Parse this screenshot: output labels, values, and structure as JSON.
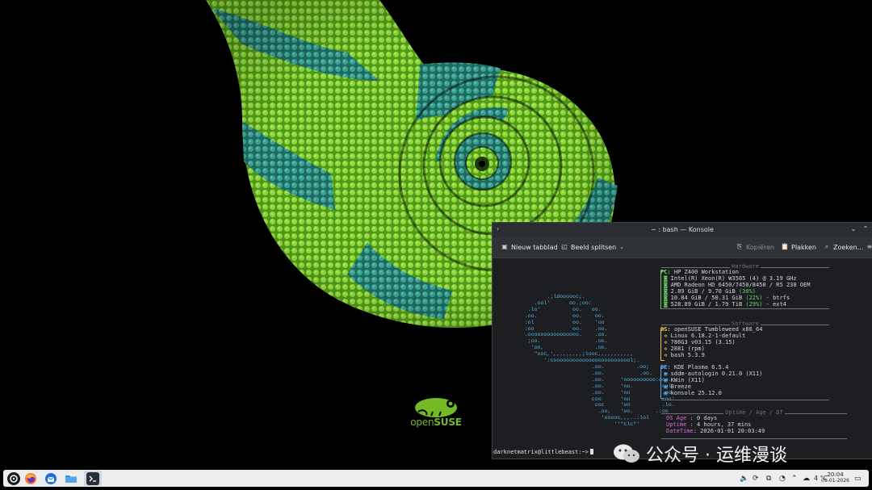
{
  "konsole": {
    "title": "~ : bash — Konsole",
    "toolbar": {
      "new_tab": "Nieuw tabblad",
      "split_view": "Beeld splitsen",
      "copy": "Kopiëren",
      "paste": "Plakken",
      "search": "Zoeken..."
    },
    "sections": {
      "hardware": "Hardware",
      "software": "Software",
      "uptime": "Uptime / Age / DT"
    },
    "hardware": [
      {
        "key": "PC:",
        "value": "HP Z400 Workstation"
      },
      {
        "key": "",
        "value": "Intel(R) Xeon(R) W3565 (4) @ 3.19 GHz"
      },
      {
        "key": "",
        "value": "AMD Radeon HD 6450/7450/8450 / R5 230 OEM"
      },
      {
        "key": "",
        "value": "2.89 GiB / 9.70 GiB ",
        "pct": "(30%)"
      },
      {
        "key": "",
        "value": "10.84 GiB / 50.31 GiB ",
        "pct": "(22%)",
        "suffix": " - btrfs"
      },
      {
        "key": "",
        "value": "528.89 GiB / 1.79 TiB ",
        "pct": "(29%)",
        "suffix": " - ext4"
      }
    ],
    "software_os": [
      {
        "key": "OS:",
        "value": "openSUSE Tumbleweed x86_64"
      },
      {
        "key": "",
        "value": "Linux 6.18.2-1-default"
      },
      {
        "key": "",
        "value": "786G3 v03.15 (3.15)"
      },
      {
        "key": "",
        "value": "2881 (rpm)"
      },
      {
        "key": "",
        "value": "bash 5.3.9"
      }
    ],
    "software_de": [
      {
        "key": "DE:",
        "value": "KDE Plasma 6.5.4"
      },
      {
        "key": "",
        "value": "sddm-autologin 0.21.0 (X11)"
      },
      {
        "key": "",
        "value": "KWin (X11)"
      },
      {
        "key": "",
        "value": "Breeze"
      },
      {
        "key": "",
        "value": "konsole 25.12.0"
      }
    ],
    "uptime": [
      {
        "key": "OS Age ",
        "value": ": 0 days"
      },
      {
        "key": "Uptime ",
        "value": ": 4 hours, 37 mins"
      },
      {
        "key": "DateTime",
        "value": ": 2026-01-01 20:03:49"
      }
    ],
    "prompt": "darknetmatrix@littlebeast:~>"
  },
  "desktop": {
    "logo_text_open": "open",
    "logo_text_suse": "SUSE"
  },
  "watermark": "公众号 · 运维漫谈",
  "taskbar": {
    "temperature": "4 °C",
    "time": "20:04",
    "date": "01-01-2026"
  },
  "colors": {
    "accent_green": "#73ba25",
    "terminal_bg": "#1c1e21",
    "taskbar_bg": "#ededed"
  },
  "icons": [
    "application-launcher-icon",
    "firefox-icon",
    "thunderbird-icon",
    "file-manager-icon",
    "konsole-icon",
    "volume-icon",
    "updates-icon",
    "network-icon",
    "wifi-icon",
    "tray-expand-icon",
    "weather-icon",
    "show-desktop-icon"
  ]
}
